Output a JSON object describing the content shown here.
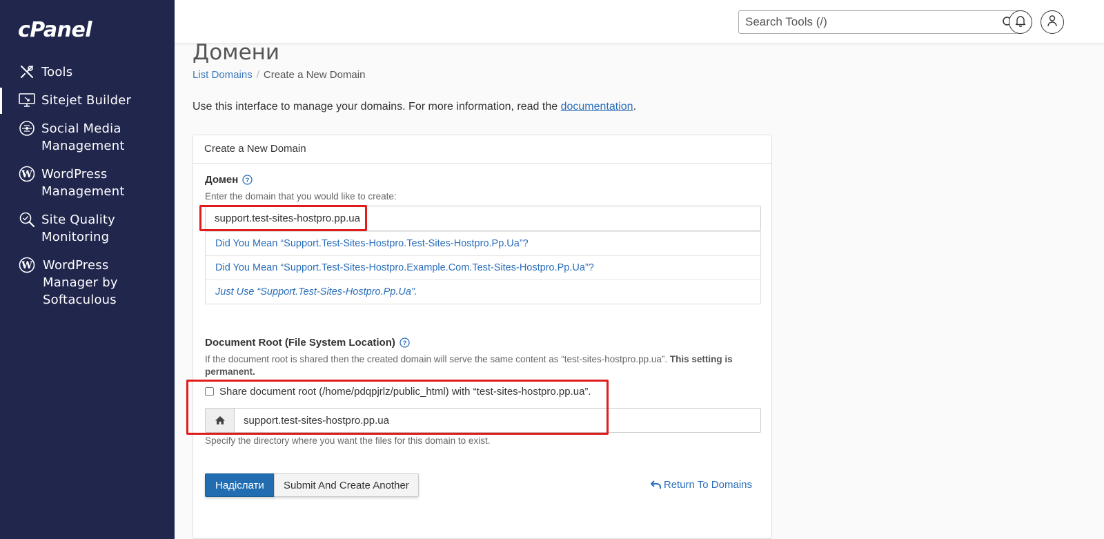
{
  "brand": {
    "logo_text": "cPanel"
  },
  "sidebar": {
    "items": [
      {
        "label": "Tools",
        "icon": "tools-icon"
      },
      {
        "label": "Sitejet Builder",
        "icon": "monitor-icon"
      },
      {
        "label": "Social Media Management",
        "icon": "social-icon"
      },
      {
        "label": "WordPress Management",
        "icon": "wordpress-icon"
      },
      {
        "label": "Site Quality Monitoring",
        "icon": "search-quality-icon"
      },
      {
        "label": "WordPress Manager by Softaculous",
        "icon": "wordpress-icon"
      }
    ]
  },
  "header": {
    "search_placeholder": "Search Tools (/)",
    "notifications_icon": "bell-icon",
    "user_icon": "user-icon"
  },
  "page": {
    "title": "Домени",
    "breadcrumb": {
      "parent": "List Domains",
      "separator": "/",
      "current": "Create a New Domain"
    },
    "intro_text": "Use this interface to manage your domains. For more information, read the ",
    "intro_link": "documentation",
    "intro_end": "."
  },
  "form": {
    "panel_title": "Create a New Domain",
    "domain_label": "Домен",
    "domain_hint": "Enter the domain that you would like to create:",
    "domain_value": "support.test-sites-hostpro.pp.ua",
    "suggestions": [
      "Did You Mean “Support.Test-Sites-Hostpro.Test-Sites-Hostpro.Pp.Ua”?",
      "Did You Mean “Support.Test-Sites-Hostpro.Example.Com.Test-Sites-Hostpro.Pp.Ua”?",
      "Just Use “Support.Test-Sites-Hostpro.Pp.Ua”."
    ],
    "docroot_label": "Document Root (File System Location)",
    "docroot_hint": "If the document root is shared then the created domain will serve the same content as “test-sites-hostpro.pp.ua”. ",
    "docroot_hint_bold": "This setting is permanent.",
    "share_label": "Share document root (/home/pdqpjrlz/public_html) with “test-sites-hostpro.pp.ua”.",
    "share_checked": false,
    "docroot_value": "support.test-sites-hostpro.pp.ua",
    "docroot_help": "Specify the directory where you want the files for this domain to exist.",
    "submit_label": "Надіслати",
    "submit_another_label": "Submit And Create Another",
    "return_label": "Return To Domains"
  },
  "colors": {
    "sidebar_bg": "#21264d",
    "primary_button": "#226db1",
    "link": "#2a6ebb",
    "highlight_box": "#e01b1b"
  }
}
